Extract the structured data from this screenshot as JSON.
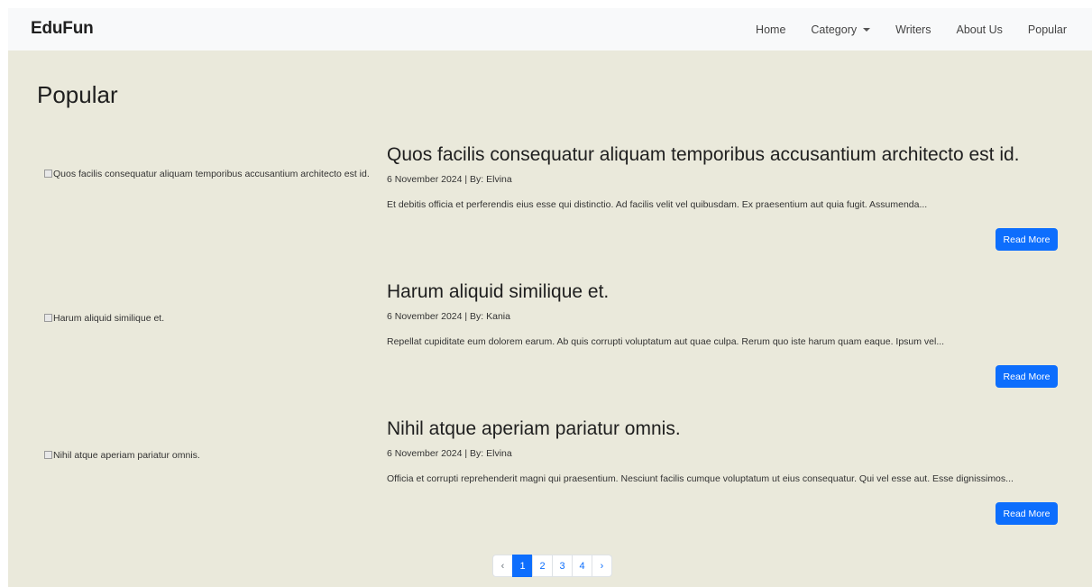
{
  "navbar": {
    "brand": "EduFun",
    "links": {
      "home": "Home",
      "category": "Category",
      "writers": "Writers",
      "about": "About Us",
      "popular": "Popular"
    }
  },
  "page": {
    "title": "Popular"
  },
  "articles": [
    {
      "image_alt": "Quos facilis consequatur aliquam temporibus accusantium architecto est id.",
      "title": "Quos facilis consequatur aliquam temporibus accusantium architecto est id.",
      "meta": "6 November 2024 | By: Elvina",
      "excerpt": "Et debitis officia et perferendis eius esse qui distinctio. Ad facilis velit vel quibusdam. Ex praesentium aut quia fugit. Assumenda...",
      "button": "Read More"
    },
    {
      "image_alt": "Harum aliquid similique et.",
      "title": "Harum aliquid similique et.",
      "meta": "6 November 2024 | By: Kania",
      "excerpt": "Repellat cupiditate eum dolorem earum. Ab quis corrupti voluptatum aut quae culpa. Rerum quo iste harum quam eaque. Ipsum vel...",
      "button": "Read More"
    },
    {
      "image_alt": "Nihil atque aperiam pariatur omnis.",
      "title": "Nihil atque aperiam pariatur omnis.",
      "meta": "6 November 2024 | By: Elvina",
      "excerpt": "Officia et corrupti reprehenderit magni qui praesentium. Nesciunt facilis cumque voluptatum ut eius consequatur. Qui vel esse aut. Esse dignissimos...",
      "button": "Read More"
    }
  ],
  "pagination": {
    "prev": "‹",
    "pages": [
      "1",
      "2",
      "3",
      "4"
    ],
    "current": "1",
    "next": "›"
  },
  "colors": {
    "page_background": "#eae9db",
    "navbar_background": "#f8f9fa",
    "primary": "#0d6efd"
  }
}
